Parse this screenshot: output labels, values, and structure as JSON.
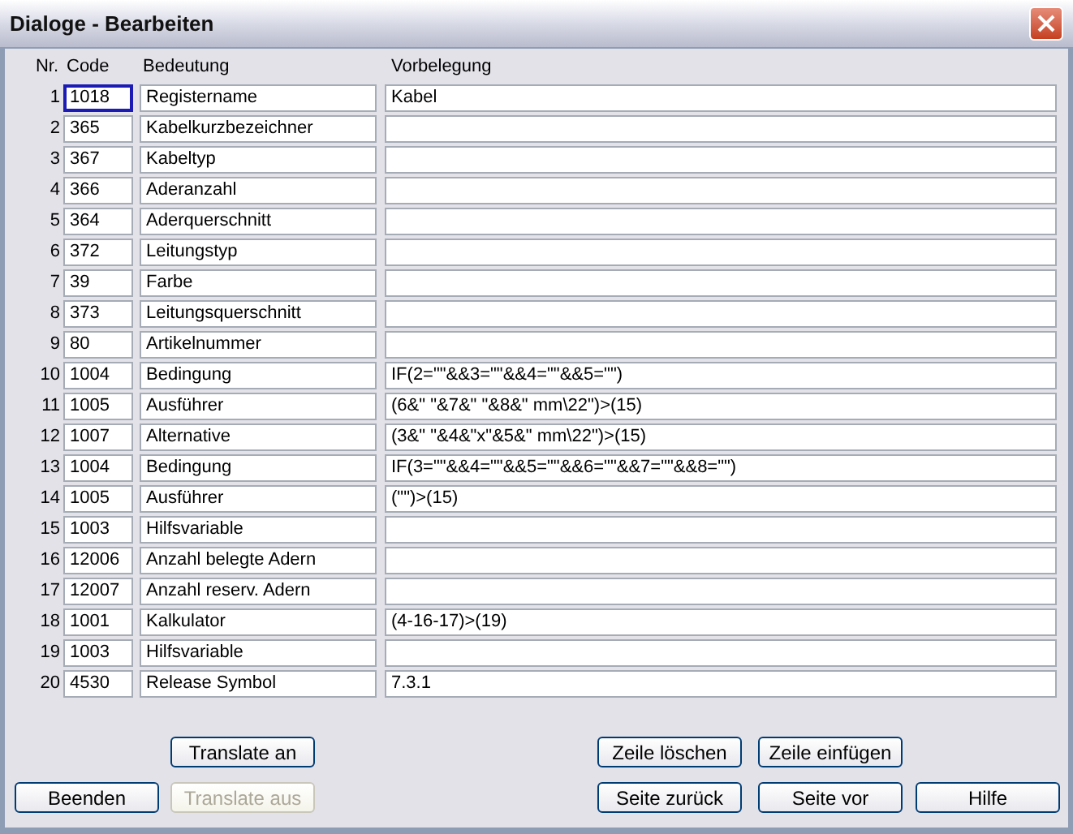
{
  "window": {
    "title": "Dialoge - Bearbeiten"
  },
  "columns": [
    "Nr.",
    "Code",
    "Bedeutung",
    "Vorbelegung"
  ],
  "rows": [
    {
      "nr": "1",
      "code": "1018",
      "meaning": "Registername",
      "default": "Kabel",
      "focused": true
    },
    {
      "nr": "2",
      "code": "365",
      "meaning": "Kabelkurzbezeichner",
      "default": "",
      "focused": false
    },
    {
      "nr": "3",
      "code": "367",
      "meaning": "Kabeltyp",
      "default": "",
      "focused": false
    },
    {
      "nr": "4",
      "code": "366",
      "meaning": "Aderanzahl",
      "default": "",
      "focused": false
    },
    {
      "nr": "5",
      "code": "364",
      "meaning": "Aderquerschnitt",
      "default": "",
      "focused": false
    },
    {
      "nr": "6",
      "code": "372",
      "meaning": "Leitungstyp",
      "default": "",
      "focused": false
    },
    {
      "nr": "7",
      "code": "39",
      "meaning": "Farbe",
      "default": "",
      "focused": false
    },
    {
      "nr": "8",
      "code": "373",
      "meaning": "Leitungsquerschnitt",
      "default": "",
      "focused": false
    },
    {
      "nr": "9",
      "code": "80",
      "meaning": "Artikelnummer",
      "default": "",
      "focused": false
    },
    {
      "nr": "10",
      "code": "1004",
      "meaning": "Bedingung",
      "default": "IF(2=\"\"&&3=\"\"&&4=\"\"&&5=\"\")",
      "focused": false
    },
    {
      "nr": "11",
      "code": "1005",
      "meaning": "Ausführer",
      "default": "(6&\" \"&7&\" \"&8&\" mm\\22\")>(15)",
      "focused": false
    },
    {
      "nr": "12",
      "code": "1007",
      "meaning": "Alternative",
      "default": "(3&\" \"&4&\"x\"&5&\" mm\\22\")>(15)",
      "focused": false
    },
    {
      "nr": "13",
      "code": "1004",
      "meaning": "Bedingung",
      "default": "IF(3=\"\"&&4=\"\"&&5=\"\"&&6=\"\"&&7=\"\"&&8=\"\")",
      "focused": false
    },
    {
      "nr": "14",
      "code": "1005",
      "meaning": "Ausführer",
      "default": "(\"\")>(15)",
      "focused": false
    },
    {
      "nr": "15",
      "code": "1003",
      "meaning": "Hilfsvariable",
      "default": "",
      "focused": false
    },
    {
      "nr": "16",
      "code": "12006",
      "meaning": "Anzahl belegte Adern",
      "default": "",
      "focused": false
    },
    {
      "nr": "17",
      "code": "12007",
      "meaning": "Anzahl reserv. Adern",
      "default": "",
      "focused": false
    },
    {
      "nr": "18",
      "code": "1001",
      "meaning": "Kalkulator",
      "default": "(4-16-17)>(19)",
      "focused": false
    },
    {
      "nr": "19",
      "code": "1003",
      "meaning": "Hilfsvariable",
      "default": "",
      "focused": false
    },
    {
      "nr": "20",
      "code": "4530",
      "meaning": "Release Symbol",
      "default": "7.3.1",
      "focused": false
    }
  ],
  "buttons_top": [
    {
      "label": "Translate an",
      "disabled": false
    },
    {
      "label": "Zeile löschen",
      "disabled": false
    },
    {
      "label": "Zeile einfügen",
      "disabled": false
    }
  ],
  "buttons_bottom": [
    {
      "label": "Beenden",
      "disabled": false
    },
    {
      "label": "Translate aus",
      "disabled": true
    },
    {
      "label": "Seite zurück",
      "disabled": false
    },
    {
      "label": "Seite vor",
      "disabled": false
    },
    {
      "label": "Hilfe",
      "disabled": false
    }
  ]
}
